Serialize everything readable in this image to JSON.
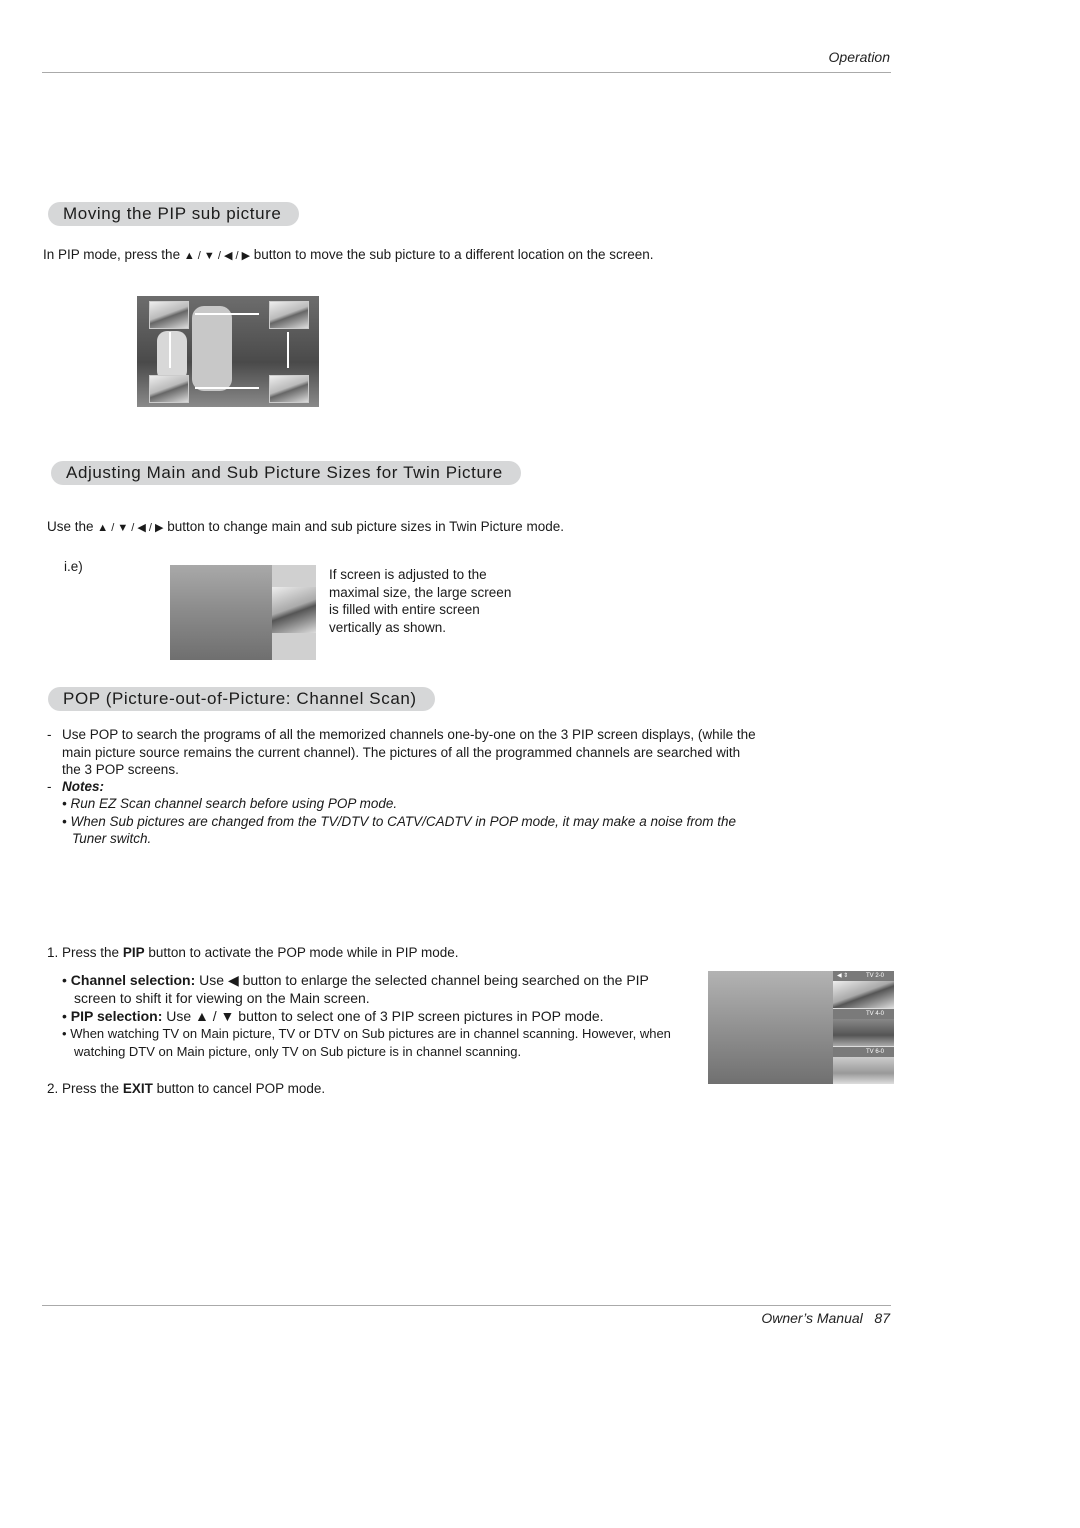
{
  "header": {
    "section": "Operation"
  },
  "sections": {
    "moving_pip": {
      "title": "Moving the PIP sub picture",
      "body_pre": "In PIP mode, press the ",
      "arrows": "▲ / ▼ / ◀ / ▶",
      "body_post": " button to move the sub picture to a different location on the screen."
    },
    "adjusting": {
      "title": "Adjusting Main and Sub Picture Sizes for Twin Picture",
      "body_pre": "Use the ",
      "arrows": "▲ / ▼ / ◀ / ▶",
      "body_post": " button to change main and sub picture sizes in Twin Picture mode.",
      "example_label": "i.e)",
      "example_text": "If screen is adjusted to the maximal size, the large screen is filled with entire screen vertically as shown."
    },
    "pop": {
      "title": "POP (Picture-out-of-Picture: Channel Scan)",
      "intro_dash": "-",
      "intro": "Use POP to search the programs of all the memorized channels one-by-one on the 3 PIP screen displays, (while the main picture source remains the current channel). The pictures of all the programmed channels are searched with the 3 POP screens.",
      "notes_dash": "-",
      "notes_label": "Notes:",
      "notes": [
        "• Run EZ Scan channel search before using POP mode.",
        "• When Sub pictures are changed from the TV/DTV to CATV/CADTV in POP mode, it may make a noise from the Tuner switch."
      ],
      "step1": {
        "num": "1.",
        "pre": "Press the ",
        "bold": "PIP",
        "post": " button to activate the POP mode while in PIP mode."
      },
      "bullets": [
        {
          "bullet": "•",
          "bold": "Channel selection:",
          "text": " Use ◀ button to enlarge the selected channel being searched on the PIP screen to shift it for viewing on the Main screen."
        },
        {
          "bullet": "•",
          "bold": "PIP selection:",
          "text": " Use ▲ / ▼ button to select one of 3 PIP screen pictures in POP mode."
        },
        {
          "bullet": "•",
          "bold": "",
          "text": "When watching TV on Main picture, TV or DTV on Sub pictures are in channel scanning. However, when watching DTV  on Main picture, only TV on Sub picture is in channel scanning."
        }
      ],
      "step2": {
        "num": "2.",
        "pre": "Press the ",
        "bold": "EXIT",
        "post": " button to cancel POP mode."
      },
      "pop_screen": {
        "nav_icons": "◀ ⇕",
        "channels": [
          "TV 2-0",
          "TV 4-0",
          "TV 6-0"
        ]
      }
    }
  },
  "footer": {
    "title": "Owner’s Manual",
    "page": "87"
  }
}
